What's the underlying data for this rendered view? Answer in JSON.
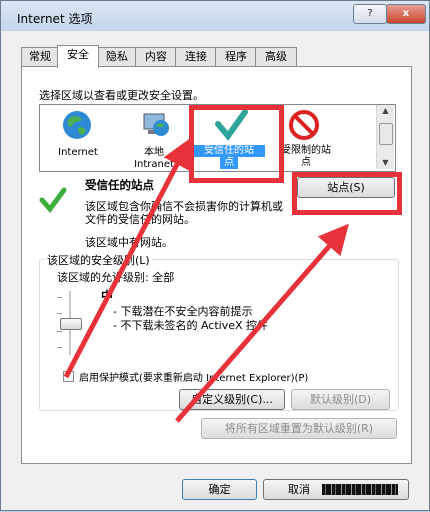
{
  "window": {
    "title": "Internet 选项",
    "help": "?",
    "close": "x"
  },
  "tabs": [
    {
      "label": "常规"
    },
    {
      "label": "安全"
    },
    {
      "label": "隐私"
    },
    {
      "label": "内容"
    },
    {
      "label": "连接"
    },
    {
      "label": "程序"
    },
    {
      "label": "高级"
    }
  ],
  "security": {
    "zone_prompt": "选择区域以查看或更改安全设置。",
    "zones": [
      {
        "line1": "Internet",
        "line2": ""
      },
      {
        "line1": "本地",
        "line2": "Intranet"
      },
      {
        "line1": "受信任的站",
        "line2": "点"
      },
      {
        "line1": "受限制的站",
        "line2": "点"
      }
    ],
    "zone_heading": "受信任的站点",
    "zone_desc_line1": "该区域包含你确信不会损害你的计算机或",
    "zone_desc_line2": "文件的受信任的网站。",
    "zone_sites_note": "该区域中有网站。",
    "sites_button": "站点(S)",
    "level_group_label": "该区域的安全级别(L)",
    "allowed_levels": "该区域的允许级别: 全部",
    "level_name": "中",
    "level_bullet1": "- 下载潜在不安全内容前提示",
    "level_bullet2": "- 不下载未签名的 ActiveX 控件",
    "protected_mode": "启用保护模式(要求重新启动 Internet Explorer)(P)",
    "custom_level_button": "自定义级别(C)...",
    "default_level_button": "默认级别(D)",
    "reset_all_button": "将所有区域重置为默认级别(R)"
  },
  "footer": {
    "ok": "确定",
    "cancel": "取消"
  },
  "colors": {
    "annotation": "#e8323a",
    "selected_zone": "#3399ff"
  }
}
